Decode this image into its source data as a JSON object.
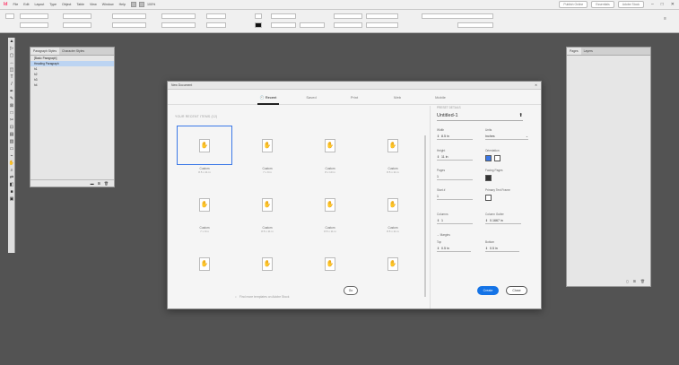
{
  "app": {
    "logo": "Id"
  },
  "menu": [
    "File",
    "Edit",
    "Layout",
    "Type",
    "Object",
    "Table",
    "View",
    "Window",
    "Help"
  ],
  "zoom": "100%",
  "topbar": {
    "publish": "Publish Online",
    "workspace": "Essentials",
    "search_placeholder": "Adobe Stock"
  },
  "left_panel": {
    "tabs": [
      "Paragraph Styles",
      "Character Styles"
    ],
    "rows": [
      "[Basic Paragraph]",
      "Heading Paragraph",
      "h1",
      "h2",
      "h3",
      "h4"
    ]
  },
  "right_panel": {
    "tabs": [
      "Pages",
      "Layers"
    ]
  },
  "dialog": {
    "title": "New Document",
    "tabs": [
      "Recent",
      "Saved",
      "Print",
      "Web",
      "Mobile"
    ],
    "recent_header": "YOUR RECENT ITEMS (12)",
    "cards": [
      {
        "label": "Custom",
        "sub": "8.5 x 11 in"
      },
      {
        "label": "Custom",
        "sub": "7 x 9 in"
      },
      {
        "label": "Custom",
        "sub": "8 x 10 in"
      },
      {
        "label": "Custom",
        "sub": "8.5 x 11 in"
      },
      {
        "label": "Custom",
        "sub": "7 x 9 in"
      },
      {
        "label": "Custom",
        "sub": "8.5 x 11 in"
      },
      {
        "label": "Custom",
        "sub": "8.5 x 11 in"
      },
      {
        "label": "Custom",
        "sub": "8.5 x 11 in"
      },
      {
        "label": "",
        "sub": ""
      },
      {
        "label": "",
        "sub": ""
      },
      {
        "label": "",
        "sub": ""
      },
      {
        "label": "",
        "sub": ""
      }
    ],
    "search_placeholder": "Find more templates on Adobe Stock",
    "go_label": "Go",
    "preset": {
      "header": "PRESET DETAILS",
      "name": "Untitled-1",
      "width_label": "Width",
      "width_value": "8.5 in",
      "units_label": "Units",
      "units_value": "Inches",
      "height_label": "Height",
      "height_value": "11 in",
      "orientation_label": "Orientation",
      "pages_label": "Pages",
      "pages_value": "1",
      "facing_label": "Facing Pages",
      "start_label": "Start #",
      "start_value": "1",
      "primary_label": "Primary Text Frame",
      "columns_label": "Columns",
      "columns_value": "1",
      "gutter_label": "Column Gutter",
      "gutter_value": "0.1667 in",
      "margins_label": "Margins",
      "top_label": "Top",
      "top_value": "0.5 in",
      "bottom_label": "Bottom",
      "bottom_value": "0.5 in"
    },
    "create_label": "Create",
    "close_label": "Close"
  }
}
